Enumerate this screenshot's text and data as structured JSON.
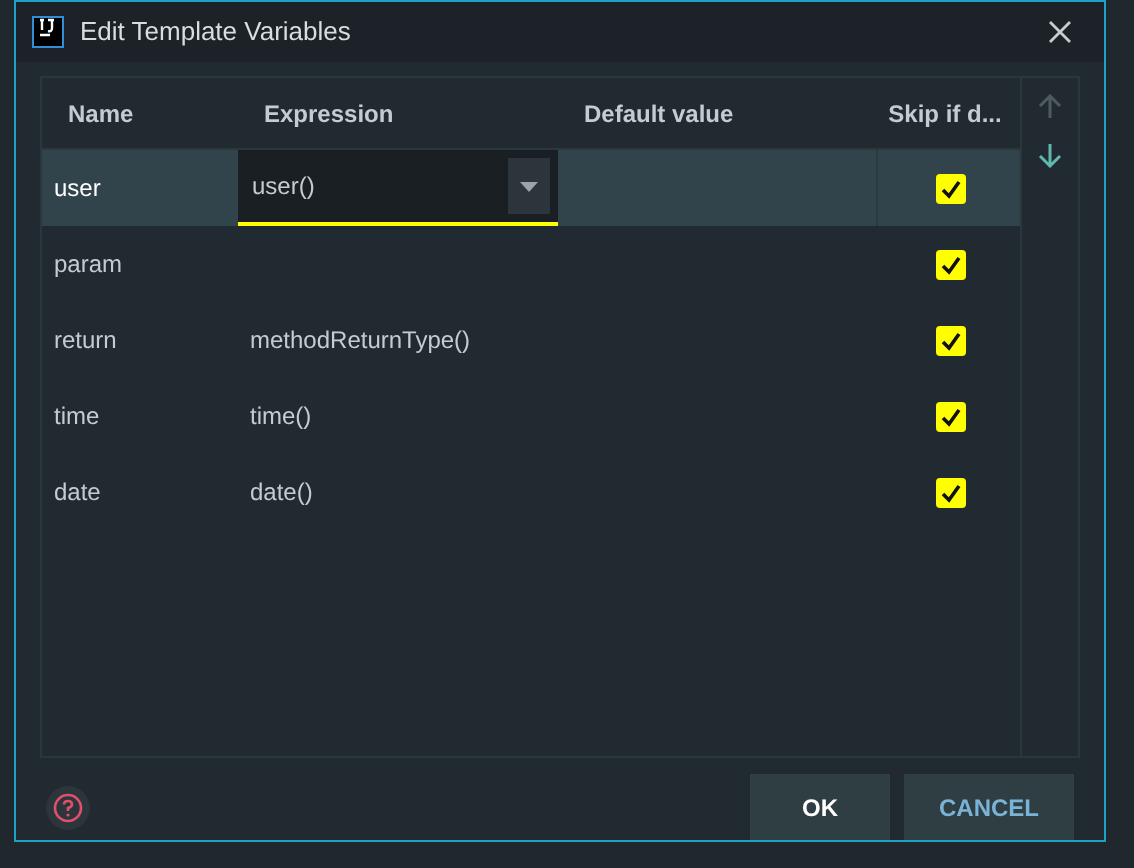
{
  "window": {
    "title": "Edit Template Variables"
  },
  "table": {
    "columns": [
      "Name",
      "Expression",
      "Default value",
      "Skip if d..."
    ],
    "rows": [
      {
        "name": "user",
        "expression": "user()",
        "skip": true,
        "selected": true
      },
      {
        "name": "param",
        "skip": true,
        "selected": false
      },
      {
        "name": "return",
        "expression": "methodReturnType()",
        "skip": true,
        "selected": false
      },
      {
        "name": "time",
        "expression": "time()",
        "skip": true,
        "selected": false
      },
      {
        "name": "date",
        "expression": "date()",
        "skip": true,
        "selected": false
      }
    ]
  },
  "toolbar": {
    "move_up_disabled": true,
    "move_down_disabled": false
  },
  "buttons": [
    {
      "label": "OK",
      "kind": "default"
    },
    {
      "label": "CANCEL",
      "kind": "cancel"
    }
  ]
}
